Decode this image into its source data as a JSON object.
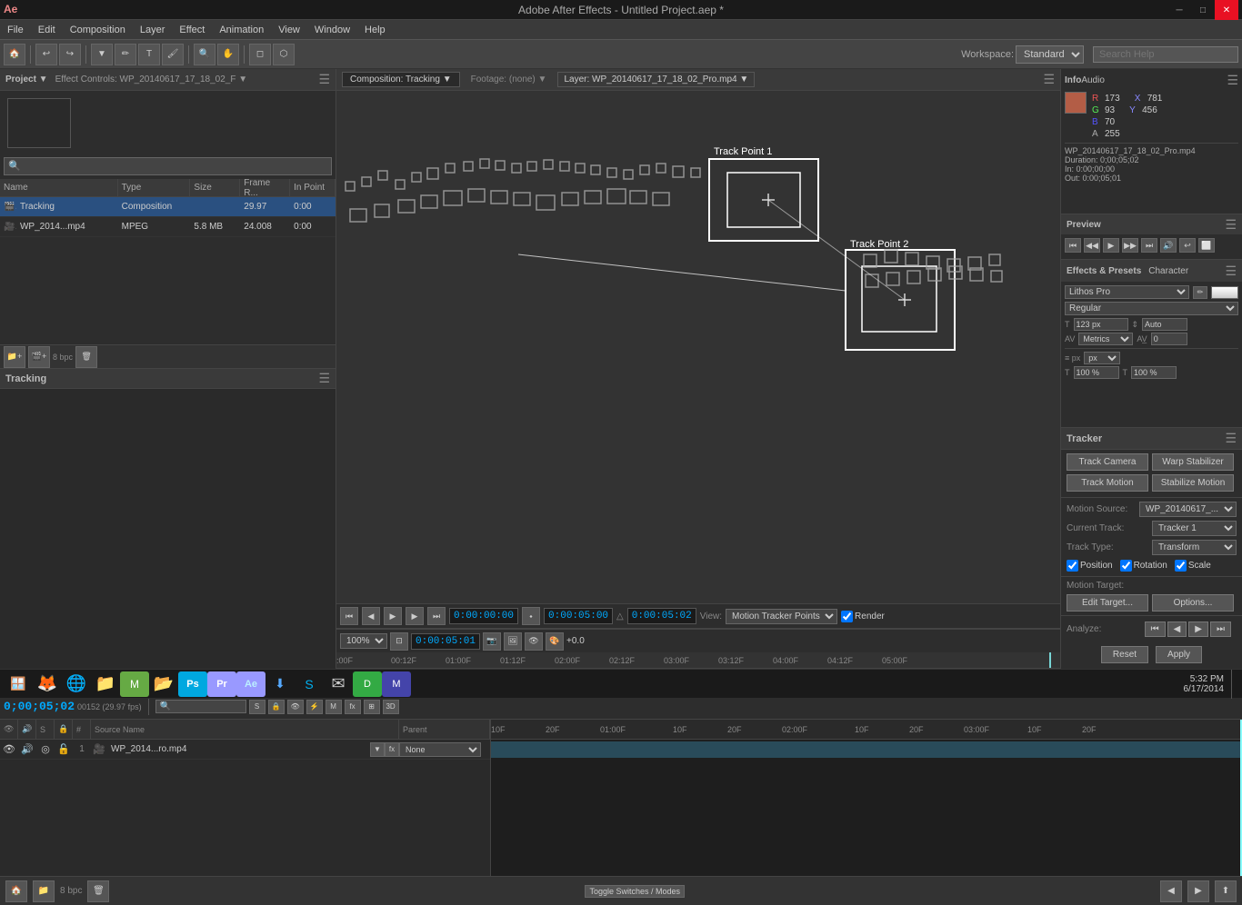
{
  "app": {
    "title": "Adobe After Effects - Untitled Project.aep *",
    "icon": "AE"
  },
  "titlebar": {
    "title": "Adobe After Effects - Untitled Project.aep *",
    "minimize": "─",
    "maximize": "□",
    "close": "✕"
  },
  "menubar": {
    "items": [
      "File",
      "Edit",
      "Composition",
      "Layer",
      "Effect",
      "Animation",
      "View",
      "Window",
      "Help"
    ]
  },
  "toolbar": {
    "workspace_label": "Workspace:",
    "workspace_value": "Standard",
    "search_placeholder": "Search Help"
  },
  "left_panel": {
    "project_header": "Project ▼",
    "effect_controls": "Effect Controls: WP_20140617_17_18_02_F ▼",
    "search_placeholder": "🔍",
    "columns": {
      "name": "Name",
      "type": "Type",
      "size": "Size",
      "fps": "Frame R...",
      "in_point": "In Point"
    },
    "items": [
      {
        "icon": "🎬",
        "name": "Tracking",
        "type": "Composition",
        "size": "",
        "fps": "29.97",
        "in": "0:00"
      },
      {
        "icon": "🎥",
        "name": "WP_2014...mp4",
        "type": "MPEG",
        "size": "5.8 MB",
        "fps": "24.008",
        "in": "0:00"
      }
    ]
  },
  "viewer": {
    "comp_tab": "Composition: Tracking",
    "footage_tab": "Footage: (none)",
    "layer_tab": "Layer: WP_20140617_17_18_02_Pro.mp4",
    "time_current": "0:00:00:00",
    "time_end": "0:00:05:00",
    "duration": "0:00:05:02",
    "zoom": "100%",
    "view_dropdown": "Motion Tracker Points",
    "render_checkbox": "Render",
    "viewer_zoom": "100%",
    "bottom_time": "0:00:05:01"
  },
  "timeline_ruler": {
    "marks": [
      "00F",
      "00:12F",
      "01:00F",
      "01:12F",
      "02:00F",
      "02:12F",
      "03:00F",
      "03:12F",
      "04:00F",
      "04:12F",
      "05:00F"
    ]
  },
  "info_panel": {
    "title": "Info",
    "audio_title": "Audio",
    "r": "R: 173",
    "g": "G: 93",
    "b": "B: 70",
    "a": "A: 255",
    "x": "X: 781",
    "y": "Y: 456",
    "filename": "WP_20140617_17_18_02_Pro.mp4",
    "duration": "Duration: 0;00;05;02",
    "in": "In: 0:00;00;00",
    "out": "Out: 0:00;05;01"
  },
  "preview_panel": {
    "title": "Preview",
    "controls": [
      "⏮",
      "◀◀",
      "▶",
      "▶▶",
      "⏭",
      "🔊",
      "↩",
      "⬜"
    ]
  },
  "effects_panel": {
    "title": "Effects & Presets",
    "character_tab": "Character",
    "font": "Lithos Pro",
    "style": "Regular",
    "size": "123 px",
    "auto": "Auto",
    "metrics": "Metrics",
    "percent1": "100 %",
    "percent2": "100 %"
  },
  "tracker_panel": {
    "title": "Tracker",
    "buttons": {
      "track_camera": "Track Camera",
      "warp_stabilizer": "Warp Stabilizer",
      "track_motion": "Track Motion",
      "stabilize_motion": "Stabilize Motion"
    },
    "motion_source_label": "Motion Source:",
    "motion_source_value": "WP_20140617_...",
    "current_track_label": "Current Track:",
    "current_track_value": "Tracker 1",
    "track_type_label": "Track Type:",
    "track_type_value": "Transform",
    "position_label": "Position",
    "rotation_label": "Rotation",
    "scale_label": "Scale",
    "motion_target_label": "Motion Target:",
    "edit_target_btn": "Edit Target...",
    "options_btn": "Options...",
    "analyze_label": "Analyze:",
    "reset_btn": "Reset",
    "apply_btn": "Apply"
  },
  "composition_panel": {
    "tab_label": "Tracking ▼",
    "time": "0;00;05;02",
    "fps_info": "00152 (29.97 fps)",
    "search_placeholder": "🔍"
  },
  "layer_panel": {
    "source_name": "Source Name",
    "parent": "Parent",
    "layers": [
      {
        "num": "1",
        "name": "WP_2014...ro.mp4",
        "parent": "None"
      }
    ]
  },
  "track_ruler": {
    "marks": [
      "10F",
      "20F",
      "01:00F",
      "10F",
      "20F",
      "02:00F",
      "10F",
      "20F",
      "03:00F",
      "10F",
      "20F"
    ]
  },
  "statusbar": {
    "bpc": "8 bpc",
    "toggle": "Toggle Switches / Modes"
  },
  "taskbar": {
    "time": "5:32 PM",
    "date": "6/17/2014",
    "icons": [
      "🦊",
      "🌐",
      "📁",
      "📊",
      "🎨",
      "🎬",
      "Ae",
      "🔄",
      "💬",
      "📧",
      "👾",
      "📱"
    ]
  },
  "track_points": {
    "point1_label": "Track Point 1",
    "point2_label": "Track Point 2"
  }
}
